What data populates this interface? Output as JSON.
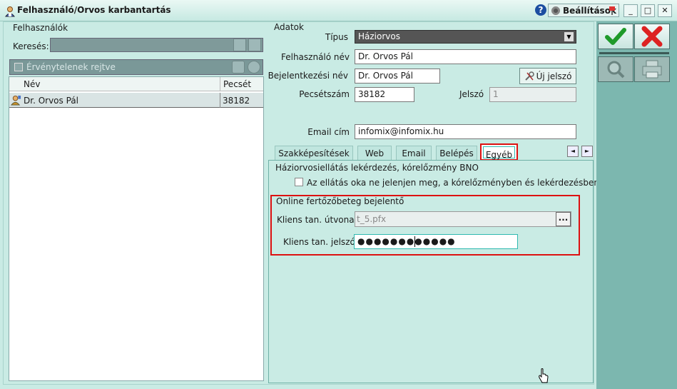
{
  "window": {
    "title": "Felhasználó/Orvos karbantartás",
    "help_label": "?",
    "settings_label": "Beállítások",
    "min_label": "_",
    "max_label": "□",
    "close_label": "✕"
  },
  "users_panel": {
    "group_label": "Felhasználók",
    "search_label": "Keresés:",
    "search_value": "",
    "filter_label": "Érvénytelenek rejtve",
    "filter_checked": false,
    "columns": [
      "Név",
      "Pecsét"
    ],
    "rows": [
      {
        "name": "Dr. Orvos Pál",
        "stamp": "38182"
      }
    ]
  },
  "data_panel": {
    "group_label": "Adatok",
    "type_label": "Típus",
    "type_value": "Háziorvos",
    "username_label": "Felhasználó név",
    "username_value": "Dr. Orvos Pál",
    "login_label": "Bejelentkezési név",
    "login_value": "Dr. Orvos Pál",
    "new_password_label": "Új jelszó",
    "stamp_label": "Pecsétszám",
    "stamp_value": "38182",
    "password_label": "Jelszó",
    "password_value": "1",
    "email_label": "Email cím",
    "email_value": "infomix@infomix.hu"
  },
  "tabs": {
    "items": [
      "Szakképesítések",
      "Web",
      "Email",
      "Belépés",
      "Egyéb"
    ],
    "active": "Egyéb",
    "prev_label": "◄",
    "next_label": "►"
  },
  "other_tab": {
    "bno_group_label": "Háziorvosiellátás lekérdezés, kórelőzmény BNO",
    "bno_checkbox_label": "Az ellátás oka ne jelenjen meg, a kórelőzményben és lekérdezésben",
    "bno_checked": false,
    "online_group_label": "Online fertőzőbeteg bejelentő",
    "client_path_label": "Kliens tan. útvonal",
    "client_path_value": "t_5.pfx",
    "browse_label": "...",
    "client_password_label": "Kliens tan. jelszó",
    "client_password_value": "●●●●●●●●●●●●"
  },
  "colors": {
    "accent": "#2fb9b0",
    "highlight_red": "#d11111",
    "window_bg": "#c9ebe4",
    "toolbar_bg": "#7cb7af"
  },
  "icons": {
    "ok": "checkmark-icon",
    "cancel": "x-mark-icon",
    "view": "magnifier-icon",
    "print": "printer-icon"
  }
}
